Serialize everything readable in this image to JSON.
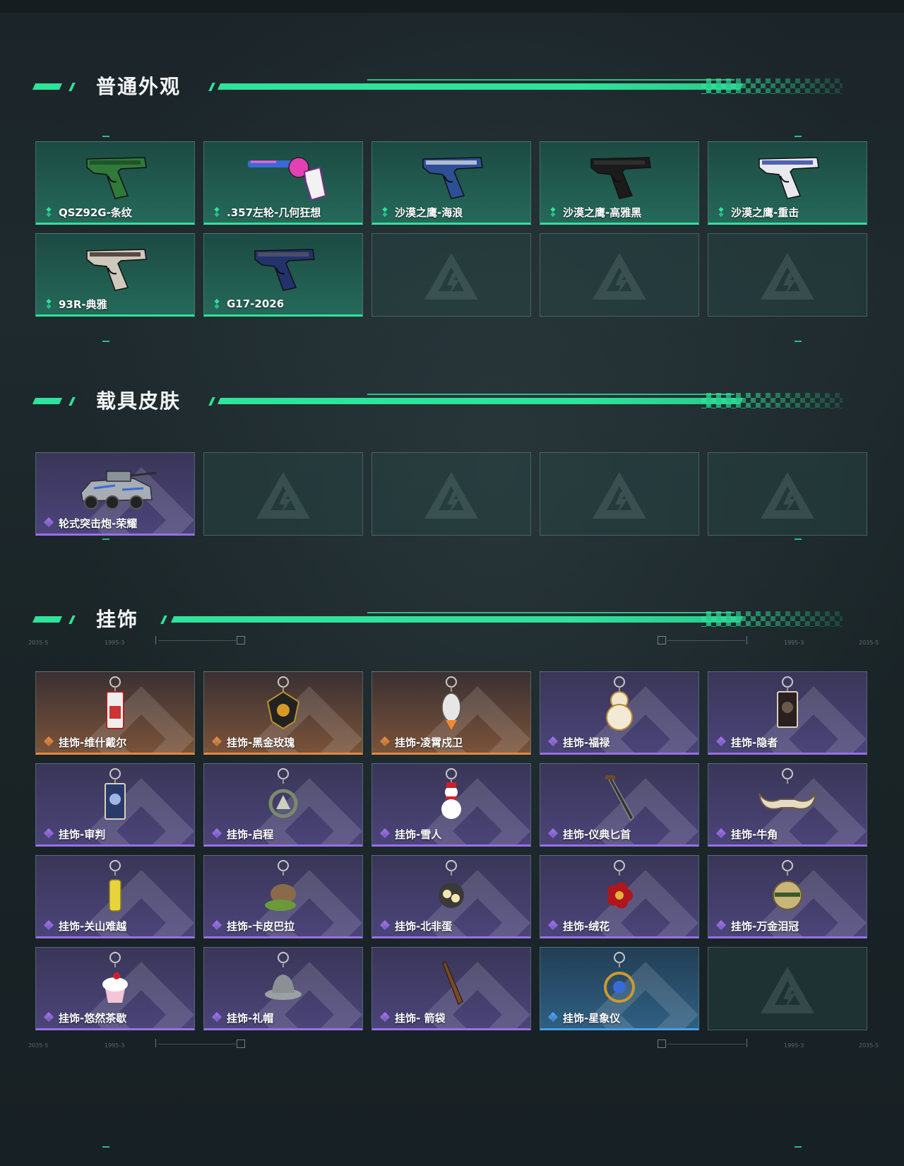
{
  "sections": {
    "weapon": {
      "title": "普通外观",
      "items": [
        {
          "name": "QSZ92G-条纹",
          "rarity": "green",
          "icon": "pistol-green-camo-icon"
        },
        {
          "name": ".357左轮-几何狂想",
          "rarity": "green",
          "icon": "revolver-pink-icon"
        },
        {
          "name": "沙漠之鹰-海浪",
          "rarity": "green",
          "icon": "desert-eagle-blue-wave-icon"
        },
        {
          "name": "沙漠之鹰-高雅黑",
          "rarity": "green",
          "icon": "desert-eagle-black-icon"
        },
        {
          "name": "沙漠之鹰-重击",
          "rarity": "green",
          "icon": "desert-eagle-white-icon"
        },
        {
          "name": "93R-典雅",
          "rarity": "green",
          "icon": "pistol-93r-icon"
        },
        {
          "name": "G17-2026",
          "rarity": "green",
          "icon": "pistol-g17-icon"
        }
      ],
      "empty_slots": 3
    },
    "vehicle": {
      "title": "载具皮肤",
      "items": [
        {
          "name": "轮式突击炮-荣耀",
          "rarity": "purple",
          "icon": "armored-vehicle-icon"
        }
      ],
      "empty_slots": 4
    },
    "charm": {
      "title": "挂饰",
      "items": [
        {
          "name": "挂饰-维什戴尔",
          "rarity": "orange",
          "icon": "charm-figure-icon"
        },
        {
          "name": "挂饰-黑金玫瑰",
          "rarity": "orange",
          "icon": "charm-black-rose-icon"
        },
        {
          "name": "挂饰-凌霄戍卫",
          "rarity": "orange",
          "icon": "charm-guard-icon"
        },
        {
          "name": "挂饰-福禄",
          "rarity": "purple",
          "icon": "charm-gourd-icon"
        },
        {
          "name": "挂饰-隐者",
          "rarity": "purple",
          "icon": "charm-tarot-card-icon"
        },
        {
          "name": "挂饰-审判",
          "rarity": "purple",
          "icon": "charm-judgement-card-icon"
        },
        {
          "name": "挂饰-启程",
          "rarity": "purple",
          "icon": "charm-ring-icon"
        },
        {
          "name": "挂饰-雪人",
          "rarity": "purple",
          "icon": "charm-snowman-icon"
        },
        {
          "name": "挂饰-仪典匕首",
          "rarity": "purple",
          "icon": "charm-dagger-icon"
        },
        {
          "name": "挂饰-牛角",
          "rarity": "purple",
          "icon": "charm-bull-horns-icon"
        },
        {
          "name": "挂饰-关山难越",
          "rarity": "purple",
          "icon": "charm-yellow-tag-icon"
        },
        {
          "name": "挂饰-卡皮巴拉",
          "rarity": "purple",
          "icon": "charm-capybara-icon"
        },
        {
          "name": "挂饰-北非蛋",
          "rarity": "purple",
          "icon": "charm-pan-icon"
        },
        {
          "name": "挂饰-绒花",
          "rarity": "purple",
          "icon": "charm-red-flower-icon"
        },
        {
          "name": "挂饰-万金泪冠",
          "rarity": "purple",
          "icon": "charm-crown-icon"
        },
        {
          "name": "挂饰-悠然茶歇",
          "rarity": "purple",
          "icon": "charm-cupcake-icon"
        },
        {
          "name": "挂饰-礼帽",
          "rarity": "purple",
          "icon": "charm-hat-icon"
        },
        {
          "name": "挂饰- 箭袋",
          "rarity": "purple",
          "icon": "charm-quiver-icon"
        },
        {
          "name": "挂饰-星象仪",
          "rarity": "blue",
          "icon": "charm-astrolabe-icon"
        }
      ],
      "empty_slots": 1
    }
  },
  "colors": {
    "accent": "#2ee39a",
    "green": "#2ee39a",
    "purple": "#9a6fe6",
    "orange": "#e08a44",
    "blue": "#4a9ee6"
  }
}
